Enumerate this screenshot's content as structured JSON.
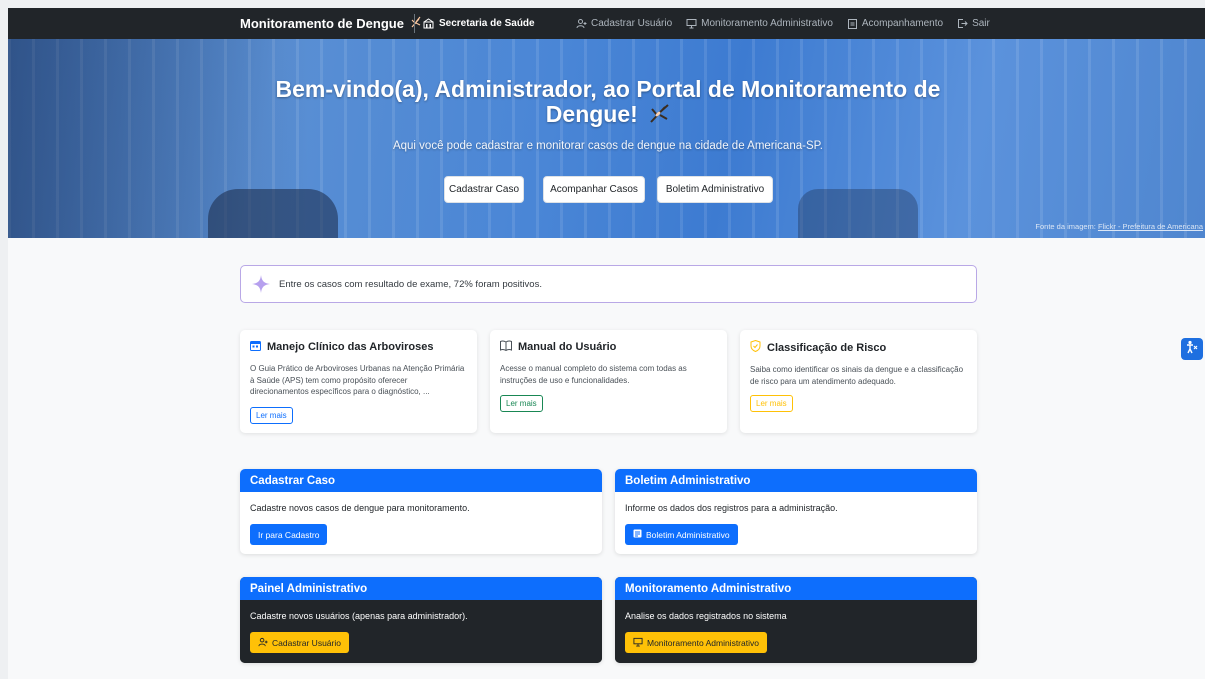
{
  "nav": {
    "brand": "Monitoramento de Dengue",
    "org": "Secretaria de Saúde",
    "links": [
      {
        "label": "Cadastrar Usuário",
        "icon": "user-add-icon"
      },
      {
        "label": "Monitoramento Administrativo",
        "icon": "monitor-icon"
      },
      {
        "label": "Acompanhamento",
        "icon": "clipboard-icon"
      },
      {
        "label": "Sair",
        "icon": "logout-icon"
      }
    ]
  },
  "hero": {
    "title": "Bem-vindo(a), Administrador, ao Portal de Monitoramento de Dengue!",
    "subtitle": "Aqui você pode cadastrar e monitorar casos de dengue na cidade de Americana-SP.",
    "buttons": [
      "Cadastrar Caso",
      "Acompanhar Casos",
      "Boletim Administrativo"
    ],
    "credit_prefix": "Fonte da imagem: ",
    "credit_link": "Flickr - Prefeitura de Americana"
  },
  "alert": {
    "text": "Entre os casos com resultado de exame, 72% foram positivos."
  },
  "info_cards": [
    {
      "title": "Manejo Clínico das Arboviroses",
      "description": "O Guia Prático de Arboviroses Urbanas na Atenção Primária à Saúde (APS) tem como propósito oferecer direcionamentos específicos para o diagnóstico, ...",
      "button": "Ler mais",
      "color": "#0d6efd"
    },
    {
      "title": "Manual do Usuário",
      "description": "Acesse o manual completo do sistema com todas as instruções de uso e funcionalidades.",
      "button": "Ler mais",
      "color": "#198754"
    },
    {
      "title": "Classificação de Risco",
      "description": "Saiba como identificar os sinais da dengue e a classificação de risco para um atendimento adequado.",
      "button": "Ler mais",
      "color": "#ffc107"
    }
  ],
  "action_cards": [
    {
      "title": "Cadastrar Caso",
      "text": "Cadastre novos casos de dengue para monitoramento.",
      "button": "Ir para Cadastro"
    },
    {
      "title": "Boletim Administrativo",
      "text": "Informe os dados dos registros para a administração.",
      "button": "Boletim Administrativo"
    },
    {
      "title": "Painel Administrativo",
      "text": "Cadastre novos usuários (apenas para administrador).",
      "button": "Cadastrar Usuário"
    },
    {
      "title": "Monitoramento Administrativo",
      "text": "Analise os dados registrados no sistema",
      "button": "Monitoramento Administrativo"
    }
  ]
}
